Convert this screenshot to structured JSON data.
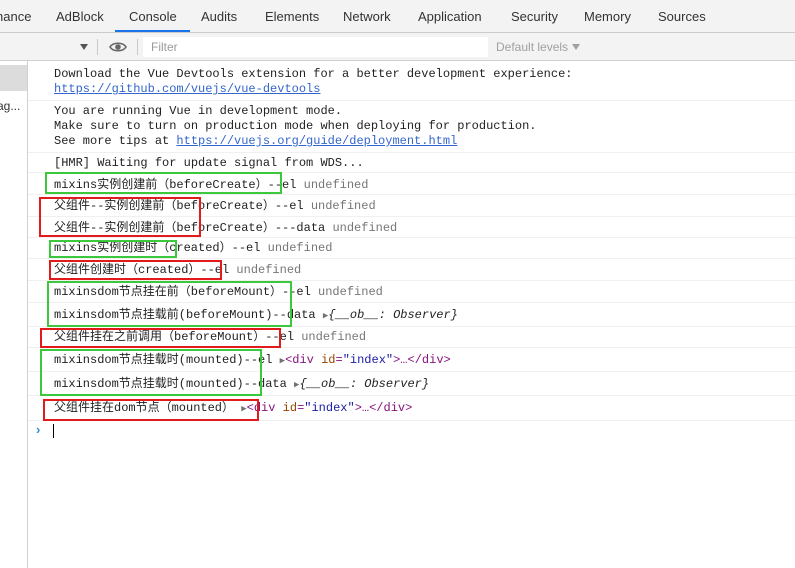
{
  "tabs": [
    {
      "label": "nance"
    },
    {
      "label": "AdBlock"
    },
    {
      "label": "Console"
    },
    {
      "label": "Audits"
    },
    {
      "label": "Elements"
    },
    {
      "label": "Network"
    },
    {
      "label": "Application"
    },
    {
      "label": "Security"
    },
    {
      "label": "Memory"
    },
    {
      "label": "Sources"
    }
  ],
  "toolbar": {
    "filter_placeholder": "Filter",
    "levels_label": "Default levels"
  },
  "sidebar": {
    "truncated_label": "ag..."
  },
  "messages": {
    "devtools": {
      "text": "Download the Vue Devtools extension for a better development experience:",
      "link": "https://github.com/vuejs/vue-devtools"
    },
    "devmode": {
      "line1": "You are running Vue in development mode.",
      "line2": "Make sure to turn on production mode when deploying for production.",
      "line3_prefix": "See more tips at ",
      "line3_link": "https://vuejs.org/guide/deployment.html"
    },
    "hmr": "[HMR] Waiting for update signal from WDS...",
    "m1": {
      "text": "mixins实例创建前（beforeCreate）--el ",
      "value": "undefined"
    },
    "m2": {
      "text": "父组件--实例创建前（beforeCreate）--el ",
      "value": "undefined"
    },
    "m3": {
      "text": "父组件--实例创建前（beforeCreate）---data ",
      "value": "undefined"
    },
    "m4": {
      "text": "mixins实例创建时（created）--el ",
      "value": "undefined"
    },
    "m5": {
      "text": "父组件创建时（created）--el ",
      "value": "undefined"
    },
    "m6": {
      "text": "mixinsdom节点挂在前（beforeMount）--el ",
      "value": "undefined"
    },
    "m7": {
      "text": "mixinsdom节点挂载前(beforeMount)--data ",
      "obj": "{__ob__: Observer}"
    },
    "m8": {
      "text": "父组件挂在之前调用（beforeMount）--el ",
      "value": "undefined"
    },
    "m9": {
      "text": "mixinsdom节点挂载时(mounted)--el ",
      "tag_open": "<div ",
      "attr_name": "id",
      "attr_eq": "=",
      "attr_value": "\"index\"",
      "tag_close": ">…</div>"
    },
    "m10": {
      "text": "mixinsdom节点挂载时(mounted)--data ",
      "obj": "{__ob__: Observer}"
    },
    "m11": {
      "text": "父组件挂在dom节点（mounted） ",
      "tag_open": "<div ",
      "attr_name": "id",
      "attr_eq": "=",
      "attr_value": "\"index\"",
      "tag_close": ">…</div>"
    }
  },
  "prompt_symbol": "›",
  "triangle_glyph": "▶",
  "colors": {
    "green_box": "#3cc83c",
    "red_box": "#e11b1b",
    "link": "#3366cc",
    "tab_underline": "#1a73e8"
  }
}
